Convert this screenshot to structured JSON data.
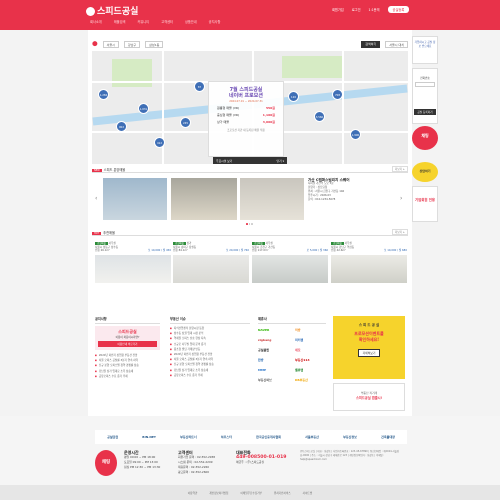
{
  "header": {
    "logo": "스피드공실",
    "links": [
      "회원가입",
      "로그인",
      "1:1문의"
    ],
    "cta": "공실등록",
    "nav": [
      "회사소개",
      "매물검색",
      "커뮤니티",
      "고객센터",
      "상품안내",
      "공지사항"
    ]
  },
  "search": {
    "location": "서울시",
    "district": "강남구",
    "dong": "삼성1동",
    "button": "검색하기",
    "toggle": "서울시 대치"
  },
  "map": {
    "clusters": [
      "1,284",
      "902",
      "1,031",
      "412",
      "245",
      "87",
      "126",
      "3,560",
      "708",
      "1,996"
    ],
    "promo": {
      "title_line1": "7월 스피드공실",
      "title_line2": "네이버 프로모션",
      "period": "2024.07.01 ~ 2024.07.31",
      "rows": [
        {
          "label": "원룸형 매물 (VR)",
          "value": "550원"
        },
        {
          "label": "중심형 매물 (VR)",
          "value": "1,100원"
        },
        {
          "label": "상가 매물",
          "value": "3,000원"
        }
      ],
      "note": "프로모션 기간 내 등록된 매물 적용"
    },
    "bottom_toggle": "주요시설 보기",
    "bottom_close": "닫기 ▾"
  },
  "featured": {
    "tag": "NEW",
    "title": "스피드 분양매물",
    "more": "더보기 +",
    "detail": {
      "title": "가산 C캠퍼스빌리지 스퀘어",
      "subtitle": "지하철 가산역 도보 5분",
      "lines": [
        "분양가 : 상담요청",
        "위치 : 서울시 금천구 가산동 146",
        "입주시기 : 2026.03",
        "문의 : 010-1234-5678"
      ]
    }
  },
  "recent": {
    "tag": "HOT",
    "title": "추천매물",
    "more": "더보기 +",
    "listings": [
      {
        "badge": "공실매물",
        "type": "사무실",
        "addr": "서울시 성동구 성수동",
        "area": "전용 26.1m²",
        "price": "보 10,000 / 월 450"
      },
      {
        "badge": "공실매물",
        "type": "상가",
        "addr": "서울시 송파구 잠실동",
        "area": "전용 84.1m²",
        "price": "보 20,000 / 월 760"
      },
      {
        "badge": "공실매물",
        "type": "사무실",
        "addr": "서울시 금천구 가산동",
        "area": "전용 117.0m²",
        "price": "보 5,000 / 월 360"
      },
      {
        "badge": "공실매물",
        "type": "사무실",
        "addr": "서울시 강남구 역삼동",
        "area": "전용 42.6m²",
        "price": "보 10,000 / 월 680"
      }
    ]
  },
  "consult": {
    "title": "공지사항",
    "brand": "스피드공실",
    "text": "이용이 처음이시라면?",
    "button": "이용안내 바로가기"
  },
  "news": {
    "title": "부동산 이슈",
    "items": [
      "2024년 하반기 상업용 부동산 전망",
      "서울 오피스 공실률 3분기 연속 하락",
      "신규 분양 오피스텔 청약 경쟁률 상승",
      "강남권 상가 임대료 소폭 상승세",
      "공유오피스 수요 증가 추세",
      "지식산업센터 분양시장 동향",
      "성수동 상권 임대 시장 분석",
      "역세권 오피스 선호 현상 지속",
      "소규모 사무실 임대 문의 증가",
      "중소형 빌딩 거래량 반등"
    ]
  },
  "family": {
    "title": "제휴사",
    "links": [
      "NAVER",
      "직방",
      "zigbang",
      "피터팬",
      "공실클럽",
      "네모",
      "한방",
      "부동산114",
      "MMP",
      "밸류맵",
      "부동산써브",
      "KB부동산"
    ]
  },
  "ad": {
    "brand": "스 피 드 공 실",
    "title": "프로모션이벤트를",
    "title2": "확인하세요!",
    "button": "자세히보기",
    "app": "부동산 직거래",
    "app2": "스피드공실 앱출시!"
  },
  "side": {
    "top": "가입하시고 공실 정보 받으세요",
    "write_btn": "공실 등록하기",
    "phone_label": "전화번호",
    "chat": "채팅",
    "talk": "상담하기",
    "corp": "기업회원 전용"
  },
  "footer": {
    "partners": [
      "공실닷컴",
      "BIN.NET",
      "부동산파트너",
      "하우스타",
      "한국공인중개사협회",
      "서울부동산",
      "부동산정보",
      "건축물대장"
    ],
    "hours_title": "운영시간",
    "hours": [
      "평일 09:00 ~ PM 18:00",
      "토요일 09:00 ~ PM 13:00",
      "점심 PM 12:30 ~ PM 13:30"
    ],
    "cs_title": "고객센터",
    "cs": [
      "회원가입 문의 : 02-552-2938",
      "시스템 문의 : 02-552-2209",
      "제휴문의 : 02-552-2260",
      "광고문의 : 02-552-2600"
    ],
    "phone_title": "대표전화",
    "phone": "449-008500-01-019",
    "phone_sub": "예금주 : (주)스피드공실",
    "company": "(주)스피드공실 | 대표 : 홍길동 | 사업자등록번호 : 123-45-67890 | 통신판매업 : 제2024-서울강남-0000 | 주소 : 서울시 강남구 테헤란로 123 | 개인정보책임자 : 홍길동 | 이메일 : help@speedroom.com",
    "bottom_links": [
      "이용약관",
      "개인정보처리방침",
      "이메일무단수집거부",
      "위치기반서비스",
      "사이트맵"
    ]
  }
}
